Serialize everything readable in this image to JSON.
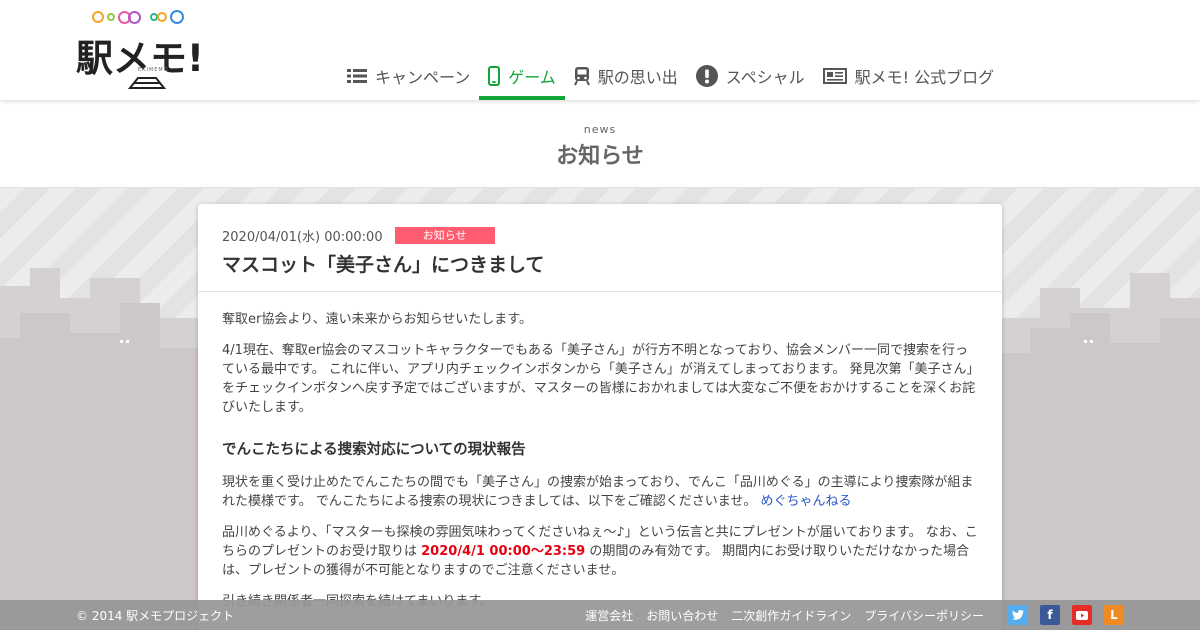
{
  "brand": {
    "logo_text": "駅メモ!",
    "logo_sub": "EKIMEMO",
    "dot_colors": [
      "#f5a623",
      "#9bc53d",
      "#e85aa3",
      "#b05ac9",
      "#2fb38a",
      "#3a8be0"
    ]
  },
  "nav": {
    "items": [
      {
        "label": "キャンペーン",
        "icon": "list-icon"
      },
      {
        "label": "ゲーム",
        "icon": "smartphone-icon"
      },
      {
        "label": "駅の思い出",
        "icon": "train-icon"
      },
      {
        "label": "スペシャル",
        "icon": "exclamation-icon"
      },
      {
        "label": "駅メモ! 公式ブログ",
        "icon": "newspaper-icon"
      }
    ],
    "active_color": "#11a53a"
  },
  "page": {
    "title_en": "news",
    "title_ja": "お知らせ"
  },
  "article": {
    "datetime": "2020/04/01(水) 00:00:00",
    "badge": "お知らせ",
    "badge_color": "#ff5c70",
    "title": "マスコット「美子さん」につきまして",
    "p1": "奪取er協会より、遠い未来からお知らせいたします。",
    "p2": "4/1現在、奪取er協会のマスコットキャラクターでもある「美子さん」が行方不明となっており、協会メンバー一同で捜索を行っている最中です。 これに伴い、アプリ内チェックインボタンから「美子さん」が消えてしまっております。 発見次第「美子さん」をチェックインボタンへ戻す予定ではございますが、マスターの皆様におかれましては大変なご不便をおかけすることを深くお詫びいたします。",
    "h3": "でんこたちによる捜索対応についての現状報告",
    "p3": "現状を重く受け止めたでんこたちの間でも「美子さん」の捜索が始まっており、でんこ「品川めぐる」の主導により捜索隊が組まれた模様です。 でんこたちによる捜索の現状につきましては、以下をご確認くださいませ。 ",
    "p3_link": "めぐちゃんねる",
    "p4_a": "品川めぐるより、「マスターも探検の雰囲気味わってくださいねぇ〜♪」という伝言と共にプレゼントが届いております。 なお、こちらのプレゼントのお受け取りは ",
    "p4_red": "2020/4/1 00:00〜23:59",
    "p4_b": " の期間のみ有効です。 期間内にお受け取りいただけなかった場合は、プレゼントの獲得が不可能となりますのでご注意くださいませ。",
    "p5": "引き続き関係者一同探索を続けてまいります。"
  },
  "footer": {
    "copyright": "© 2014 駅メモプロジェクト",
    "links": [
      "運営会社",
      "お問い合わせ",
      "二次創作ガイドライン",
      "プライバシーポリシー"
    ],
    "social": [
      {
        "icon": "twitter-icon",
        "color": "#55acee",
        "glyph": ""
      },
      {
        "icon": "facebook-icon",
        "color": "#3b5998",
        "glyph": "f"
      },
      {
        "icon": "youtube-icon",
        "color": "#e52d27",
        "glyph": ""
      },
      {
        "icon": "line-blog-icon",
        "color": "#f08a24",
        "glyph": "L"
      }
    ]
  }
}
